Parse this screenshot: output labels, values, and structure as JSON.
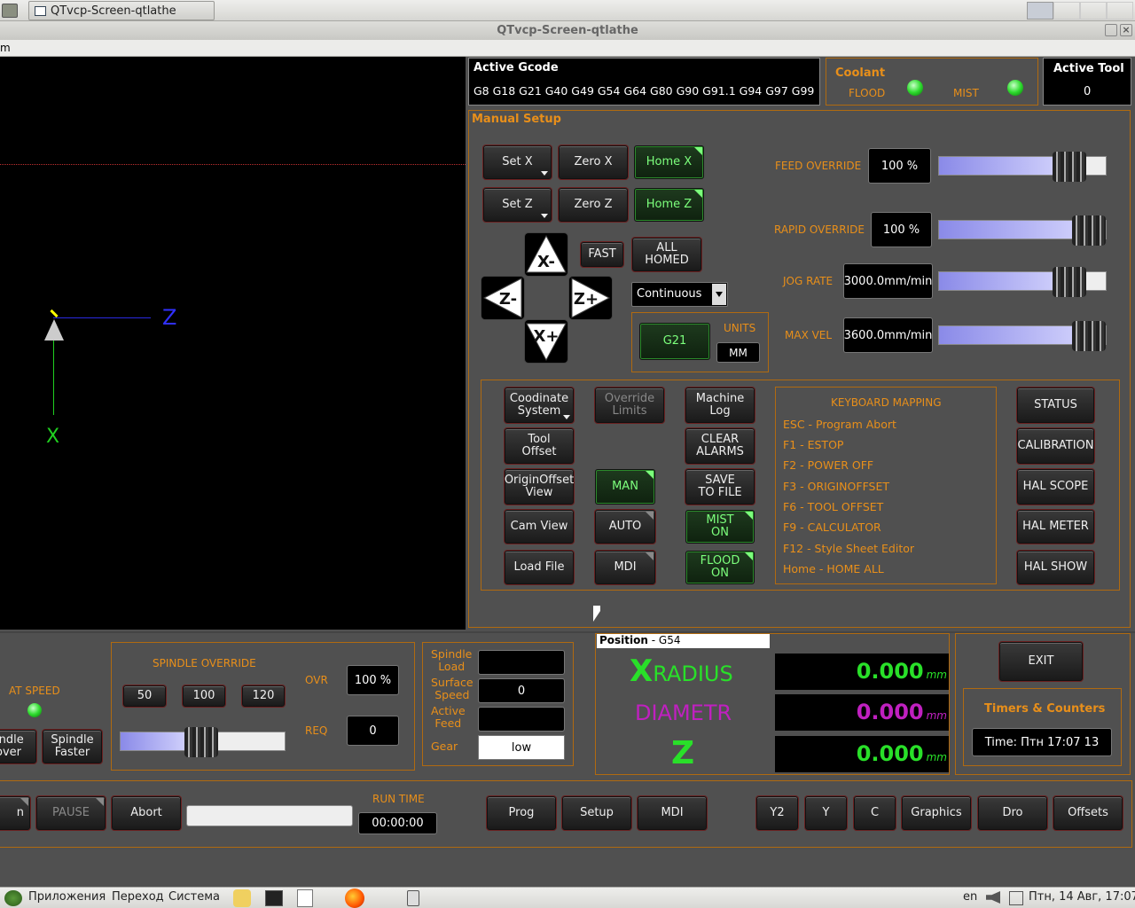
{
  "window": {
    "taskbar_title": "QTvcp-Screen-qtlathe",
    "title": "QTvcp-Screen-qtlathe",
    "menu": "m"
  },
  "gcode": {
    "heading": "Active Gcode",
    "codes": "G8 G18 G21 G40 G49 G54 G64 G80 G90 G91.1 G94 G97 G99"
  },
  "coolant": {
    "heading": "Coolant",
    "flood": "FLOOD",
    "mist": "MIST"
  },
  "tool": {
    "heading": "Active Tool",
    "value": "0"
  },
  "manual": {
    "heading": "Manual Setup",
    "set_x": "Set X",
    "zero_x": "Zero X",
    "home_x": "Home X",
    "set_z": "Set Z",
    "zero_z": "Zero Z",
    "home_z": "Home Z",
    "fast": "FAST",
    "all_homed": "ALL HOMED",
    "jog_mode": "Continuous",
    "g21": "G21",
    "units_label": "UNITS",
    "units": "MM"
  },
  "jog": {
    "x_minus": "X-",
    "x_plus": "X+",
    "z_minus": "Z-",
    "z_plus": "Z+"
  },
  "overrides": {
    "feed_label": "FEED OVERRIDE",
    "feed_value": "100 %",
    "feed_level": 0.85,
    "rapid_label": "RAPID OVERRIDE",
    "rapid_value": "100 %",
    "rapid_level": 1.0,
    "jog_label": "JOG RATE",
    "jog_value": "3000.0mm/min",
    "jog_level": 0.85,
    "maxvel_label": "MAX VEL",
    "maxvel_value": "3600.0mm/min",
    "maxvel_level": 1.0
  },
  "tools": {
    "coord": "Coodinate\nSystem",
    "override_limits": "Override\nLimits",
    "machine_log": "Machine\nLog",
    "tool_offset": "Tool\nOffset",
    "clear_alarms": "CLEAR\nALARMS",
    "origin_view": "OriginOffset\nView",
    "man": "MAN",
    "save_file": "SAVE\nTO FILE",
    "cam_view": "Cam View",
    "auto": "AUTO",
    "mist_on": "MIST\nON",
    "load_file": "Load File",
    "mdi": "MDI",
    "flood_on": "FLOOD\nON"
  },
  "keymap": {
    "heading": "KEYBOARD MAPPING",
    "lines": [
      "ESC - Program Abort",
      "F1 - ESTOP",
      "F2 - POWER OFF",
      "F3 - ORIGINOFFSET",
      "F6 - TOOL OFFSET",
      "F9 - CALCULATOR",
      "F12 - Style Sheet Editor",
      "Home - HOME ALL"
    ]
  },
  "side": {
    "status": "STATUS",
    "calibration": "CALIBRATION",
    "hal_scope": "HAL SCOPE",
    "hal_meter": "HAL METER",
    "hal_show": "HAL SHOW"
  },
  "preview": {
    "z_axis": "Z",
    "x_axis": "X"
  },
  "spindle": {
    "at_speed": "AT SPEED",
    "slower": "indle\nover",
    "faster": "Spindle\nFaster",
    "override_heading": "SPINDLE OVERRIDE",
    "p50": "50",
    "p100": "100",
    "p120": "120",
    "ovr_label": "OVR",
    "ovr_value": "100 %",
    "req_label": "REQ",
    "req_value": "0",
    "override_level": 0.47,
    "load_label": "Spindle\nLoad",
    "surface_label": "Surface\nSpeed",
    "surface_value": "0",
    "feed_label": "Active\nFeed",
    "gear_label": "Gear",
    "gear_value": "low"
  },
  "position": {
    "heading": "Position",
    "system": " - G54",
    "x_letter": "X",
    "x_name": "RADIUS",
    "x_value": "0.000",
    "d_name": "DIAMETR",
    "d_value": "0.000",
    "z_letter": "Z",
    "z_value": "0.000",
    "unit": "mm"
  },
  "exit": {
    "label": "EXIT",
    "timers_heading": "Timers & Counters",
    "time": "Time:  Птн 17:07 13"
  },
  "bottom": {
    "run": "n",
    "pause": "PAUSE",
    "abort": "Abort",
    "runtime_label": "RUN TIME",
    "runtime": "00:00:00",
    "prog": "Prog",
    "setup": "Setup",
    "mdi": "MDI",
    "y2": "Y2",
    "y": "Y",
    "c": "C",
    "graphics": "Graphics",
    "dro": "Dro",
    "offsets": "Offsets"
  },
  "os": {
    "apps": "Приложения",
    "go": "Переход",
    "system": "Система",
    "lang": "en",
    "clock": "Птн, 14 Авг, 17:07"
  }
}
